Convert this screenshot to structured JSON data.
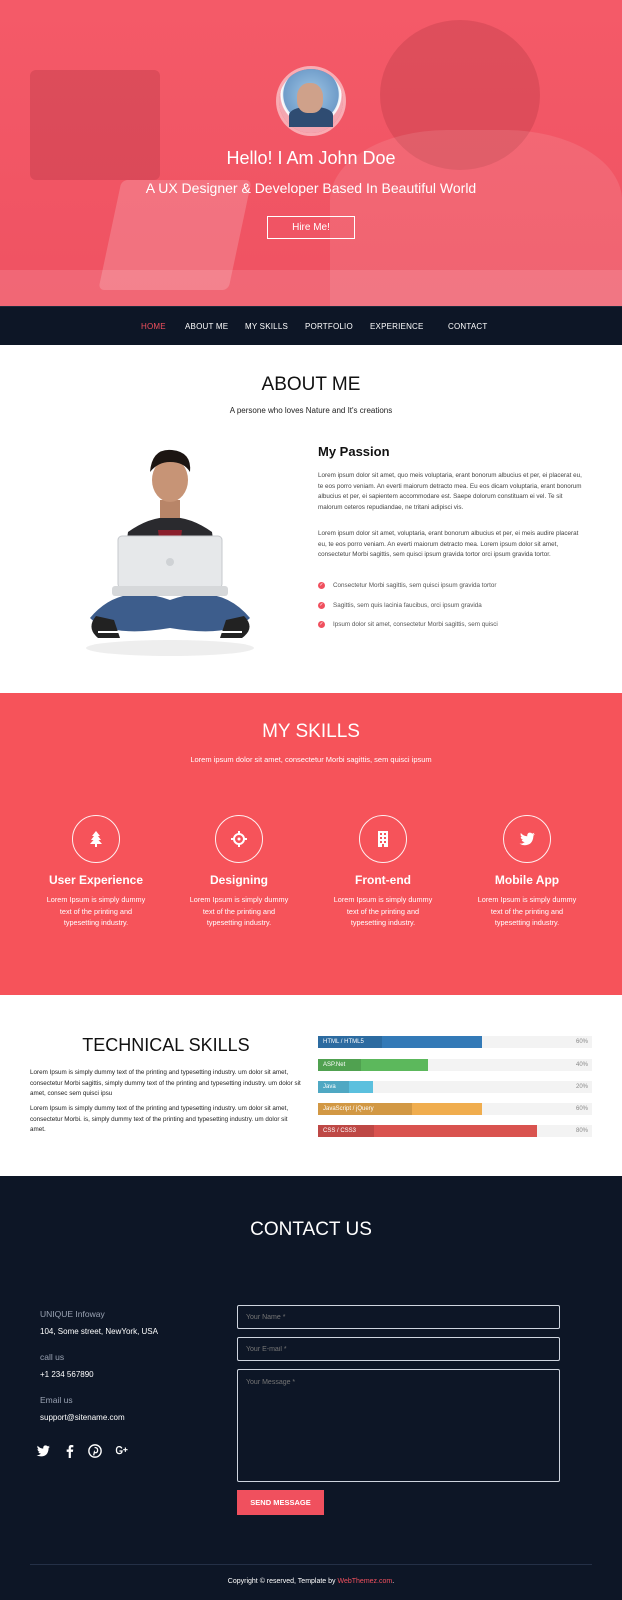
{
  "hero": {
    "title": "Hello! I Am John Doe",
    "subtitle": "A UX Designer & Developer Based In Beautiful World",
    "button": "Hire Me!"
  },
  "nav": {
    "items": [
      "HOME",
      "ABOUT ME",
      "MY SKILLS",
      "PORTFOLIO",
      "EXPERIENCE",
      "CONTACT"
    ],
    "active": "HOME"
  },
  "about": {
    "title": "ABOUT ME",
    "subtitle": "A persone who loves Nature and It's creations",
    "passion_title": "My Passion",
    "para1": "Lorem ipsum dolor sit amet, quo meis voluptaria, erant bonorum albucius et per, ei placerat eu, te eos porro veniam. An everti maiorum detracto mea. Eu eos dicam voluptaria, erant bonorum albucius et per, ei sapientem accommodare est. Saepe dolorum constituam ei vel. Te sit malorum ceteros repudiandae, ne tritani adipisci vis.",
    "para2": "Lorem ipsum dolor sit amet, voluptaria, erant bonorum albucius et per, ei meis audire placerat eu, te eos porro veniam. An everti maiorum detracto mea. Lorem ipsum dolor sit amet, consectetur Morbi sagittis, sem quisci ipsum gravida tortor orci ipsum gravida tortor.",
    "list": [
      "Consectetur Morbi sagittis, sem quisci ipsum gravida tortor",
      "Sagittis, sem quis lacinia faucibus, orci ipsum gravida",
      "Ipsum dolor sit amet, consectetur Morbi sagittis, sem quisci"
    ]
  },
  "skills": {
    "title": "MY SKILLS",
    "subtitle": "Lorem ipsum dolor sit amet, consectetur Morbi sagittis, sem quisci ipsum",
    "items": [
      {
        "name": "User Experience",
        "desc": "Lorem Ipsum is simply dummy text of the printing and typesetting industry.",
        "icon": "tree-icon"
      },
      {
        "name": "Designing",
        "desc": "Lorem Ipsum is simply dummy text of the printing and typesetting industry.",
        "icon": "crosshair-icon"
      },
      {
        "name": "Front-end",
        "desc": "Lorem Ipsum is simply dummy text of the printing and typesetting industry.",
        "icon": "building-icon"
      },
      {
        "name": "Mobile App",
        "desc": "Lorem Ipsum is simply dummy text of the printing and typesetting industry.",
        "icon": "twitter-icon"
      }
    ]
  },
  "tech": {
    "title": "TECHNICAL SKILLS",
    "para1": "Lorem Ipsum is simply dummy text of the printing and typesetting industry. um dolor sit amet, consectetur Morbi sagittis, simply dummy text of the printing and typesetting industry. um dolor sit amet, consec sem quisci ipsu",
    "para2": "Lorem Ipsum is simply dummy text of the printing and typesetting industry. um dolor sit amet, consectetur Morbi. is, simply dummy text of the printing and typesetting industry. um dolor sit amet.",
    "bars": [
      {
        "label": "HTML / HTML5",
        "percent": 60,
        "pct_text": "60%",
        "color": "#337ab7"
      },
      {
        "label": "ASP.Net",
        "percent": 40,
        "pct_text": "40%",
        "color": "#5cb85c"
      },
      {
        "label": "Java",
        "percent": 20,
        "pct_text": "20%",
        "color": "#5bc0de"
      },
      {
        "label": "JavaScript / jQuery",
        "percent": 60,
        "pct_text": "60%",
        "color": "#f0ad4e"
      },
      {
        "label": "CSS / CSS3",
        "percent": 80,
        "pct_text": "80%",
        "color": "#d9534f"
      }
    ]
  },
  "contact": {
    "title": "CONTACT US",
    "company": "UNIQUE Infoway",
    "address": "104, Some street, NewYork, USA",
    "call_label": "call us",
    "phone": "+1 234 567890",
    "email_label": "Email us",
    "email": "support@sitename.com",
    "social": [
      "twitter-icon",
      "facebook-icon",
      "pinterest-icon",
      "google-plus-icon"
    ],
    "name_placeholder": "Your Name *",
    "email_placeholder": "Your E-mail *",
    "message_placeholder": "Your Message *",
    "send": "SEND MESSAGE"
  },
  "footer": {
    "text": "Copyright © reserved, Template by ",
    "link": "WebThemez.com",
    "end": "."
  },
  "colors": {
    "accent": "#f0505e",
    "dark": "#0d1626",
    "skills_bg": "#f6535a"
  }
}
